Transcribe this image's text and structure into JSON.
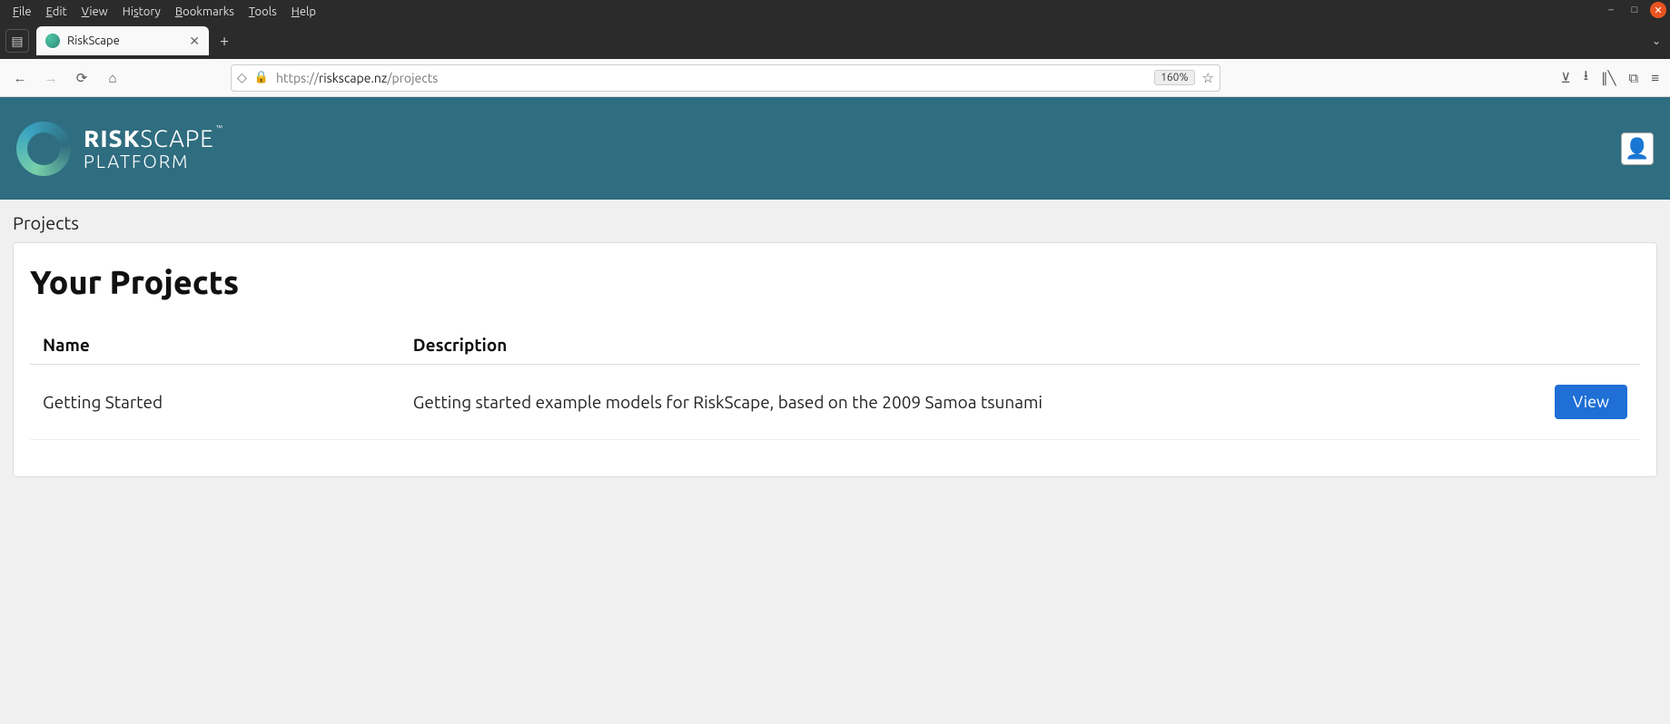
{
  "os_menu": [
    "File",
    "Edit",
    "View",
    "History",
    "Bookmarks",
    "Tools",
    "Help"
  ],
  "browser": {
    "tab_title": "RiskScape",
    "url_prefix": "https://",
    "url_domain": "riskscape.nz",
    "url_path": "/projects",
    "zoom": "160%"
  },
  "app": {
    "logo_bold": "RISK",
    "logo_light": "SCAPE",
    "logo_tm": "™",
    "logo_sub": "PLATFORM",
    "breadcrumb": "Projects",
    "heading": "Your Projects",
    "columns": {
      "name": "Name",
      "description": "Description"
    },
    "projects": [
      {
        "name": "Getting Started",
        "description": "Getting started example models for RiskScape, based on the 2009 Samoa tsunami",
        "action": "View"
      }
    ]
  }
}
